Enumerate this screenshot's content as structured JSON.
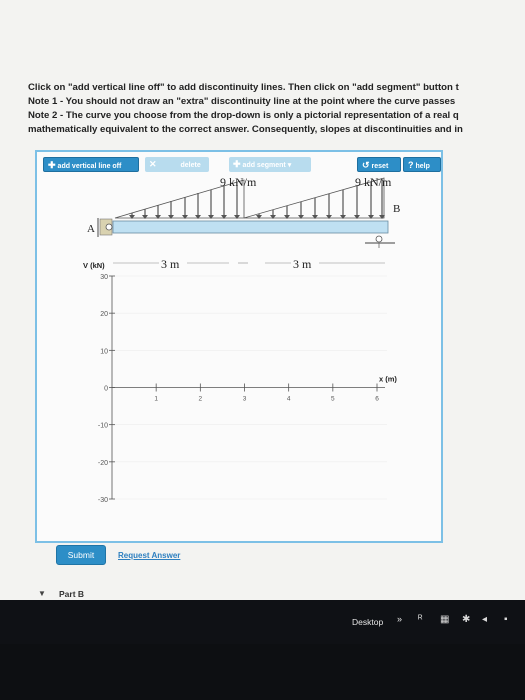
{
  "instructions": [
    "Click on \"add vertical line off\" to add discontinuity lines. Then click on \"add segment\" button t",
    "Note 1 - You should not draw an \"extra\" discontinuity line at the point where the curve passes",
    "Note 2 - The curve you choose from the drop-down is only a pictorial representation of a real q",
    "mathematically equivalent to the correct answer. Consequently, slopes at discontinuities and in"
  ],
  "toolbar": {
    "add_line_label": "add vertical line off",
    "delete_label": "delete",
    "add_segment_label": "add segment",
    "reset_label": "reset",
    "help_label": "help"
  },
  "beam": {
    "load_left": "9 kN/m",
    "load_right": "9 kN/m",
    "support_a": "A",
    "support_b": "B",
    "span_left": "3 m",
    "span_right": "3 m"
  },
  "chart_data": {
    "type": "line",
    "xlabel": "x (m)",
    "ylabel": "V (kN)",
    "xlim": [
      0,
      6
    ],
    "ylim": [
      -30,
      30
    ],
    "x_ticks": [
      1,
      2,
      3,
      4,
      5,
      6
    ],
    "y_ticks": [
      30,
      20,
      10,
      0,
      -10,
      -20,
      -30
    ],
    "x_tick_labels": [
      "1",
      "2",
      "3",
      "4",
      "5",
      "6"
    ],
    "y_tick_labels": [
      "30",
      "20",
      "10",
      "0",
      "-10",
      "-20",
      "-30"
    ],
    "series": []
  },
  "actions": {
    "submit_label": "Submit",
    "request_label": "Request Answer"
  },
  "part_b": {
    "label": "Part B"
  },
  "taskbar": {
    "desktop_label": "Desktop"
  },
  "colors": {
    "accent": "#2d8ec7",
    "panel_border": "#7cc0e6",
    "beam": "#bfe0f2"
  }
}
